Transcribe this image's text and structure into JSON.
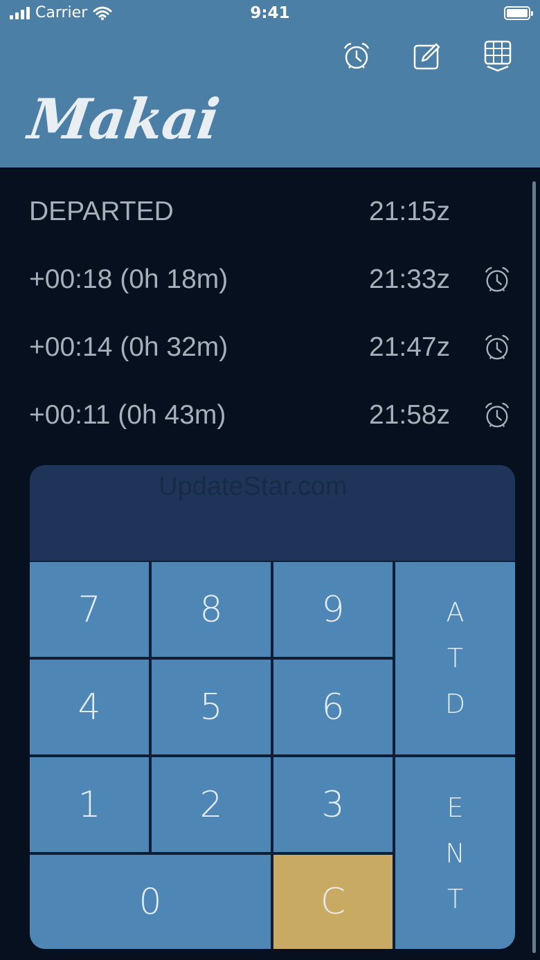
{
  "status": {
    "carrier": "Carrier",
    "time": "9:41"
  },
  "app": {
    "title": "Makai"
  },
  "toolbar": {
    "icons": [
      "alarm-icon",
      "edit-icon",
      "grid-dropdown-icon"
    ]
  },
  "timeline": [
    {
      "label": "DEPARTED",
      "time": "21:15z",
      "alarm": false
    },
    {
      "label": "+00:18 (0h 18m)",
      "time": "21:33z",
      "alarm": true
    },
    {
      "label": "+00:14 (0h 32m)",
      "time": "21:47z",
      "alarm": true
    },
    {
      "label": "+00:11 (0h 43m)",
      "time": "21:58z",
      "alarm": true
    }
  ],
  "keypad": {
    "watermark": "UpdateStar.com",
    "keys": {
      "k7": "7",
      "k8": "8",
      "k9": "9",
      "k4": "4",
      "k5": "5",
      "k6": "6",
      "k1": "1",
      "k2": "2",
      "k3": "3",
      "k0": "0",
      "clear": "C"
    },
    "atd": [
      "A",
      "T",
      "D"
    ],
    "ent": [
      "E",
      "N",
      "T"
    ]
  },
  "colors": {
    "header": "#4b7fa5",
    "background": "#06101e",
    "key": "#4e87b6",
    "clear": "#c9aa63",
    "display": "#1e3559"
  }
}
